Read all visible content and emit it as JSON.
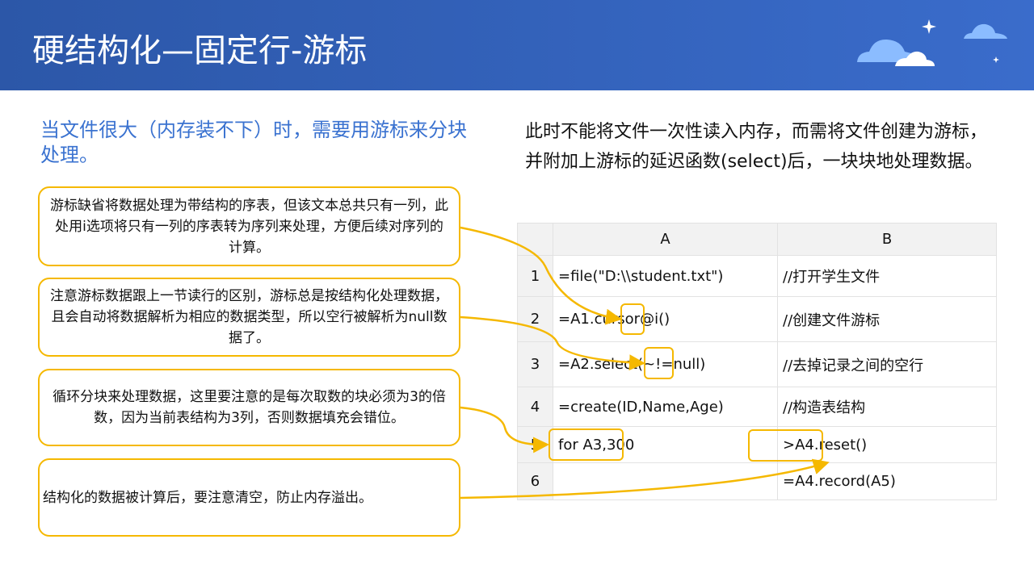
{
  "title": "硬结构化—固定行-游标",
  "left_heading": "当文件很大（内存装不下）时，需要用游标来分块处理。",
  "right_text": "此时不能将文件一次性读入内存，而需将文件创建为游标，并附加上游标的延迟函数(select)后，一块块地处理数据。",
  "callouts": [
    "游标缺省将数据处理为带结构的序表，但该文本总共只有一列，此处用i选项将只有一列的序表转为序列来处理，方便后续对序列的计算。",
    "注意游标数据跟上一节读行的区别，游标总是按结构化处理数据，且会自动将数据解析为相应的数据类型，所以空行被解析为null数据了。",
    "循环分块来处理数据，这里要注意的是每次取数的块必须为3的倍数，因为当前表结构为3列，否则数据填充会错位。",
    "结构化的数据被计算后，要注意清空，防止内存溢出。"
  ],
  "table": {
    "columns": [
      "A",
      "B"
    ],
    "rows": [
      {
        "n": "1",
        "a": "=file(\"D:\\\\student.txt\")",
        "b": "//打开学生文件"
      },
      {
        "n": "2",
        "a": "=A1.cursor@i()",
        "b": "//创建文件游标"
      },
      {
        "n": "3",
        "a": "=A2.select(~!=null)",
        "b": "//去掉记录之间的空行"
      },
      {
        "n": "4",
        "a": "=create(ID,Name,Age)",
        "b": "//构造表结构"
      },
      {
        "n": "5",
        "a": "for A3,300",
        "b": ">A4.reset()"
      },
      {
        "n": "6",
        "a": "",
        "b": "=A4.record(A5)"
      }
    ]
  },
  "colors": {
    "accent": "#f5b800",
    "header": "#2c57a8"
  }
}
